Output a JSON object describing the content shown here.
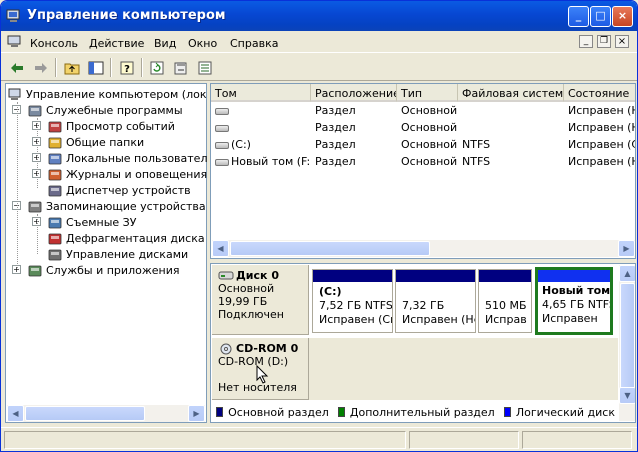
{
  "window": {
    "title": "Управление компьютером"
  },
  "menu": [
    "Консоль",
    "Действие",
    "Вид",
    "Окно",
    "Справка"
  ],
  "tree": {
    "root": "Управление компьютером (локаль",
    "items": [
      {
        "label": "Служебные программы",
        "level": 1
      },
      {
        "label": "Просмотр событий",
        "level": 2
      },
      {
        "label": "Общие папки",
        "level": 2
      },
      {
        "label": "Локальные пользователи и",
        "level": 2
      },
      {
        "label": "Журналы и оповещения пр",
        "level": 2
      },
      {
        "label": "Диспетчер устройств",
        "level": 2
      },
      {
        "label": "Запоминающие устройства",
        "level": 1
      },
      {
        "label": "Съемные ЗУ",
        "level": 2
      },
      {
        "label": "Дефрагментация диска",
        "level": 2
      },
      {
        "label": "Управление дисками",
        "level": 2
      },
      {
        "label": "Службы и приложения",
        "level": 1
      }
    ]
  },
  "volumes": {
    "columns": [
      "Том",
      "Расположение",
      "Тип",
      "Файловая система",
      "Состояние"
    ],
    "rows": [
      [
        "",
        "Раздел",
        "Основной",
        "",
        "Исправен (Не"
      ],
      [
        "",
        "Раздел",
        "Основной",
        "",
        "Исправен (Не"
      ],
      [
        "(C:)",
        "Раздел",
        "Основной",
        "NTFS",
        "Исправен (Си"
      ],
      [
        "Новый том (F:)",
        "Раздел",
        "Основной",
        "NTFS",
        "Исправен (Не"
      ]
    ]
  },
  "disk0": {
    "name": "Диск 0",
    "type": "Основной",
    "size": "19,99 ГБ",
    "status": "Подключен",
    "partitions": [
      {
        "title": "(C:)",
        "size": "7,52 ГБ NTFS",
        "status": "Исправен (Си"
      },
      {
        "title": "",
        "size": "7,32 ГБ",
        "status": "Исправен (Не"
      },
      {
        "title": "",
        "size": "510 МБ",
        "status": "Исправ"
      },
      {
        "title": "Новый том",
        "size": "4,65 ГБ NTFS",
        "status": "Исправен"
      }
    ]
  },
  "cdrom0": {
    "name": "CD-ROM 0",
    "drive": "CD-ROM (D:)",
    "status": "Нет носителя"
  },
  "legend": [
    {
      "label": "Основной раздел",
      "color": "#000080"
    },
    {
      "label": "Дополнительный раздел",
      "color": "#008000"
    },
    {
      "label": "Логический диск",
      "color": "#0000FF"
    }
  ]
}
